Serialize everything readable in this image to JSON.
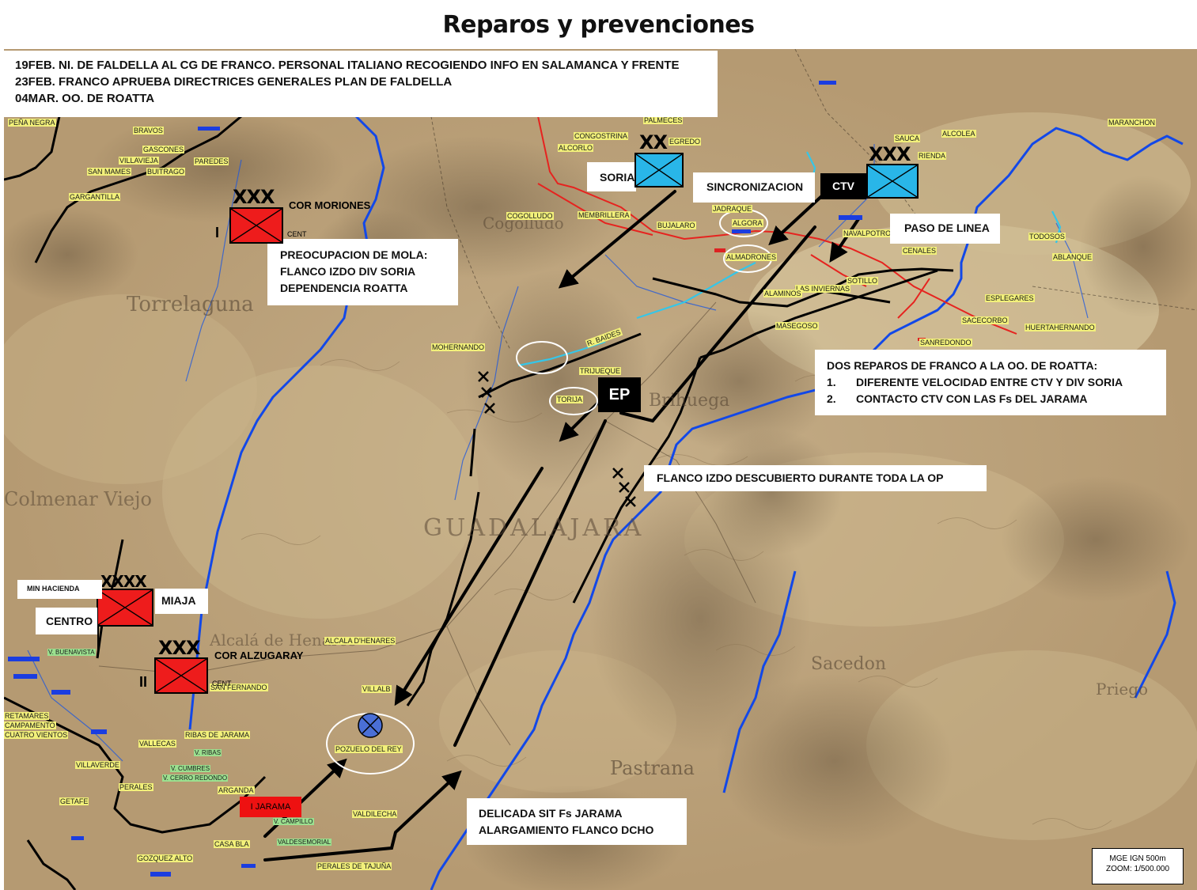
{
  "title": "Reparos y prevenciones",
  "header_notes": [
    "19FEB. NI. DE FALDELLA AL CG DE FRANCO.  PERSONAL ITALIANO RECOGIENDO INFO EN SALAMANCA Y FRENTE",
    "23FEB. FRANCO APRUEBA DIRECTRICES GENERALES PLAN DE FALDELLA",
    "04MAR. OO. DE ROATTA"
  ],
  "callouts": {
    "mola": [
      "PREOCUPACION DE MOLA:",
      "FLANCO IZDO DIV SORIA",
      "DEPENDENCIA ROATTA"
    ],
    "sincronizacion": "SINCRONIZACION",
    "paso_linea": "PASO DE LINEA",
    "reparos_title": "DOS REPAROS DE FRANCO A LA OO. DE ROATTA:",
    "reparos_items": [
      {
        "num": "1.",
        "text": "DIFERENTE VELOCIDAD ENTRE  CTV Y DIV SORIA"
      },
      {
        "num": "2.",
        "text": "CONTACTO CTV CON LAS Fs DEL JARAMA"
      }
    ],
    "flanco_izdo": "FLANCO IZDO DESCUBIERTO DURANTE TODA LA OP",
    "jarama": [
      "DELICADA SIT Fs JARAMA",
      "ALARGAMIENTO FLANCO DCHO"
    ]
  },
  "units": {
    "soria": {
      "label": "SORIA",
      "echelon": "XX",
      "color": "#29b6e8"
    },
    "ctv": {
      "label": "CTV",
      "echelon": "XXX",
      "color": "#29b6e8"
    },
    "cor_moriones": {
      "label": "COR MORIONES",
      "echelon": "XXX",
      "sub": "CENT",
      "roman": "I",
      "color": "#ee1c1c"
    },
    "miaja": {
      "label": "MIAJA",
      "echelon": "XXXX",
      "color": "#ee1c1c"
    },
    "centro": "CENTRO",
    "min_hacienda": "MIN HACIENDA",
    "cor_alzugaray": {
      "label": "COR ALZUGARAY",
      "echelon": "XXX",
      "sub": "CENT",
      "roman": "II",
      "color": "#ee1c1c"
    },
    "ep": "EP",
    "i_jarama": "I JARAMA"
  },
  "boundary_marks": [
    "XXX",
    "XXX"
  ],
  "places": {
    "pozuelo": "POZUELO DEL REY",
    "villalbilla": "VILLALB",
    "alcala": "ALCALA D'HENARES",
    "trijueque": "TRIJUEQUE",
    "mohernando": "MOHERNANDO",
    "cogolludo": "COGOLLUDO",
    "jadraque": "JADRAQUE",
    "algora": "ALGORA",
    "almadrones": "ALMADRONES",
    "alaminos": "ALAMINOS",
    "masegoso": "MASEGOSO",
    "sanredondo": "SANREDONDO",
    "esplegares": "ESPLEGARES",
    "huertahernando": "HUERTAHERNANDO",
    "ablanque": "ABLANQUE",
    "sacecorbo": "SACECORBO",
    "sotillo": "SOTILLO",
    "las_inviernas": "LAS INVIERNAS",
    "palmeces": "PALMECES",
    "congostrina": "CONGOSTRINA",
    "alcorlo": "ALCORLO",
    "membrillera": "MEMBRILLERA",
    "bujalaro": "BUJALARO",
    "baides": "R. BAIDES",
    "torija": "TORIJA",
    "sauca": "SAUCA",
    "alcolea": "ALCOLEA",
    "maranchon": "MARANCHON",
    "rienda": "RIENDA",
    "navalpotro": "NAVALPOTRO",
    "cendales": "CENALES",
    "pena_negra": "PEÑA NEGRA",
    "bravo": "BRAVOS",
    "gascones": "GASCONES",
    "villavieja": "VILLAVIEJA",
    "buitrago": "BUITRAGO",
    "paredes": "PAREDES",
    "san_mames": "SAN MAMES",
    "gargantilla": "GARGANTILLA",
    "perales": "PERALES",
    "perales_tajuna": "PERALES DE TAJUÑA",
    "valdilecha": "VALDILECHA",
    "ribas": "RIBAS DE JARAMA",
    "vallecas": "VALLECAS",
    "getafe": "GETAFE",
    "retamares": "RETAMARES",
    "campamento": "CAMPAMENTO",
    "cuatro_vientos": "CUATRO VIENTOS",
    "villaverde": "VILLAVERDE",
    "arganda": "ARGANDA",
    "campillo": "V. CAMPILLO",
    "valdesemorial": "VALDESEMORIAL",
    "gozquez": "GOZQUEZ ALTO",
    "casa_blanca": "CASA BLA",
    "san_fernando": "SAN FERNANDO",
    "v_cumbres": "V. CUMBRES",
    "v_cerro": "V. CERRO REDONDO",
    "v_ribas": "V. RIBAS",
    "v_buenavista": "V. BUENAVISTA",
    "gasch": "EGREDO",
    "todosos": "TODOSOS"
  },
  "map_lettering": {
    "guadalajara": "GUADALAJARA",
    "torrelaguna": "Torrelaguna",
    "brihuega": "Brihuega",
    "pastrana": "Pastrana",
    "sacedon": "Sacedon",
    "priego": "Priego",
    "alcala_h": "Alcalá de Henares",
    "cogolludo_big": "Cogolludo",
    "colmenar": "Colmenar Viejo"
  },
  "scale": {
    "line1": "MGE IGN 500m",
    "line2": "ZOOM: 1/500.000"
  },
  "colors": {
    "map_base": "#b59a72",
    "river": "#1248e8",
    "red_line": "#e6231f",
    "nationalist_blue": "#29b6e8",
    "republican_red": "#ee1c1c",
    "arrow": "#000000"
  }
}
